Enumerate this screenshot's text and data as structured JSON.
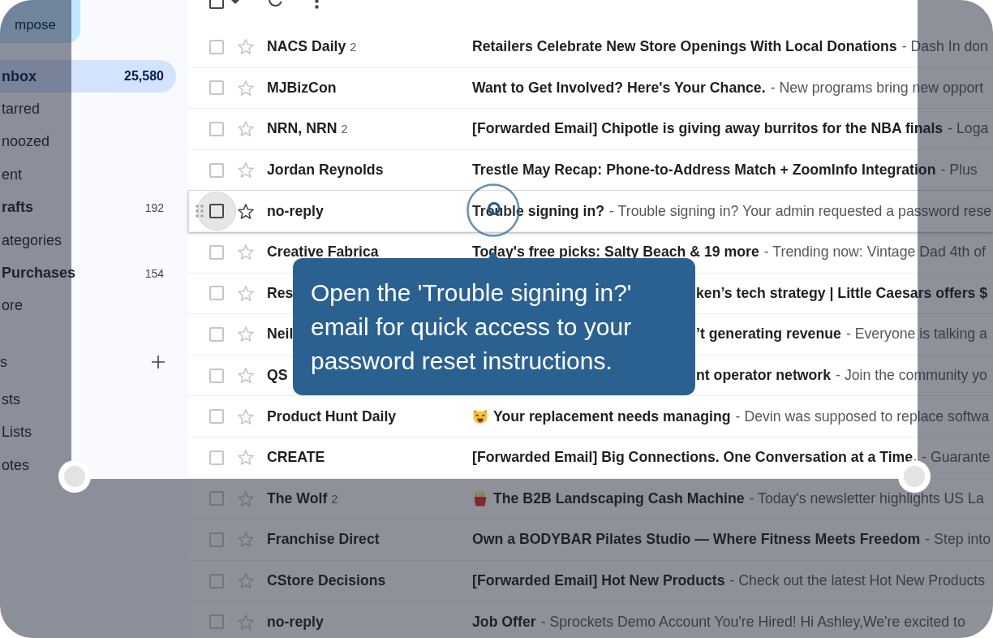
{
  "compose": {
    "label": "mpose"
  },
  "sidebar": {
    "items": [
      {
        "label": "nbox",
        "count": "25,580",
        "selected": true,
        "unread": true
      },
      {
        "label": "tarred",
        "selected": false,
        "unread": false
      },
      {
        "label": "noozed",
        "selected": false,
        "unread": false
      },
      {
        "label": "ent",
        "selected": false,
        "unread": false
      },
      {
        "label": "rafts",
        "count": "192",
        "selected": false,
        "unread": true
      },
      {
        "label": "ategories",
        "selected": false,
        "unread": false
      },
      {
        "label": "Purchases",
        "count": "154",
        "selected": false,
        "unread": true
      },
      {
        "label": "ore",
        "selected": false,
        "unread": false
      }
    ],
    "labels_heading": "s",
    "labels": [
      {
        "label": "sts",
        "selected": false,
        "unread": false
      },
      {
        "label": "Lists",
        "selected": false,
        "unread": false
      },
      {
        "label": "otes",
        "selected": false,
        "unread": false
      }
    ]
  },
  "toolbar": {
    "select_all": {
      "checked": false
    }
  },
  "rows": [
    {
      "sender": "NACS Daily",
      "count": "2",
      "subject": "Retailers Celebrate New Store Openings With Local Donations",
      "snippet": "- Dash In don",
      "kind": "plain",
      "checked": false,
      "starred": false,
      "hovered": false
    },
    {
      "sender": "MJBizCon",
      "subject": "Want to Get Involved? Here's Your Chance.",
      "snippet": "- New programs bring new opport",
      "kind": "plain",
      "checked": false,
      "starred": false,
      "hovered": false
    },
    {
      "sender": "NRN, NRN",
      "count": "2",
      "subject": "[Forwarded Email] Chipotle is giving away burritos for the NBA finals",
      "snippet": "- Loga",
      "kind": "plain",
      "checked": false,
      "starred": false,
      "hovered": false
    },
    {
      "sender": "Jordan Reynolds",
      "subject": "Trestle May Recap: Phone-to-Address Match + ZoomInfo Integration",
      "snippet": "- Plus",
      "kind": "plain",
      "checked": false,
      "starred": false,
      "hovered": false
    },
    {
      "sender": "no-reply",
      "subject": "Trouble signing in?",
      "snippet": "- Trouble signing in? Your admin requested a password rese",
      "kind": "plain",
      "checked": false,
      "starred": false,
      "hovered": true
    },
    {
      "sender": "Creative Fabrica",
      "subject": "Today's free picks: Salty Beach & 19 more",
      "snippet": "- Trending now: Vintage Dad 4th of",
      "kind": "plain",
      "checked": false,
      "starred": false,
      "hovered": false
    },
    {
      "sender": "Res",
      "subject": "ken’s tech strategy | Little Caesars offers $",
      "kind": "covered",
      "checked": false,
      "starred": false,
      "hovered": false
    },
    {
      "sender": "Neil",
      "subject": "’t generating revenue",
      "snippet": "- Everyone is talking a",
      "kind": "covered",
      "checked": false,
      "starred": false,
      "hovered": false
    },
    {
      "sender": "QS",
      "subject": "nt operator network",
      "snippet": "- Join the community yo",
      "kind": "covered",
      "checked": false,
      "starred": false,
      "hovered": false
    },
    {
      "sender": "Product Hunt Daily",
      "subject": "Your replacement needs managing",
      "snippet": "- Devin was supposed to replace softwa",
      "kind": "cat",
      "checked": false,
      "starred": false,
      "hovered": false
    },
    {
      "sender": "CREATE",
      "subject": "[Forwarded Email] Big Connections. One Conversation at a Time.",
      "snippet": "- Guarante",
      "kind": "plain",
      "checked": false,
      "starred": false,
      "hovered": false
    },
    {
      "sender": "The Wolf",
      "count": "2",
      "subject": "The B2B Landscaping Cash Machine",
      "snippet": "- Today's newsletter highlights US La",
      "kind": "fries",
      "checked": false,
      "starred": false,
      "hovered": false
    },
    {
      "sender": "Franchise Direct",
      "subject": "Own a BODYBAR Pilates Studio — Where Fitness Meets Freedom",
      "snippet": "- Step into",
      "kind": "plain",
      "checked": false,
      "starred": false,
      "hovered": false
    },
    {
      "sender": "CStore Decisions",
      "subject": "[Forwarded Email] Hot New Products",
      "snippet": "- Check out the latest Hot New Products",
      "kind": "plain",
      "checked": false,
      "starred": false,
      "hovered": false
    },
    {
      "sender": "no-reply",
      "subject": "Job Offer",
      "snippet": "- Sprockets Demo Account You're Hired! Hi Ashley,We're excited to",
      "kind": "plain",
      "checked": false,
      "starred": false,
      "hovered": false
    }
  ],
  "tooltip": {
    "text": "Open the 'Trouble signing in?' email for quick access to your password reset instructions."
  }
}
